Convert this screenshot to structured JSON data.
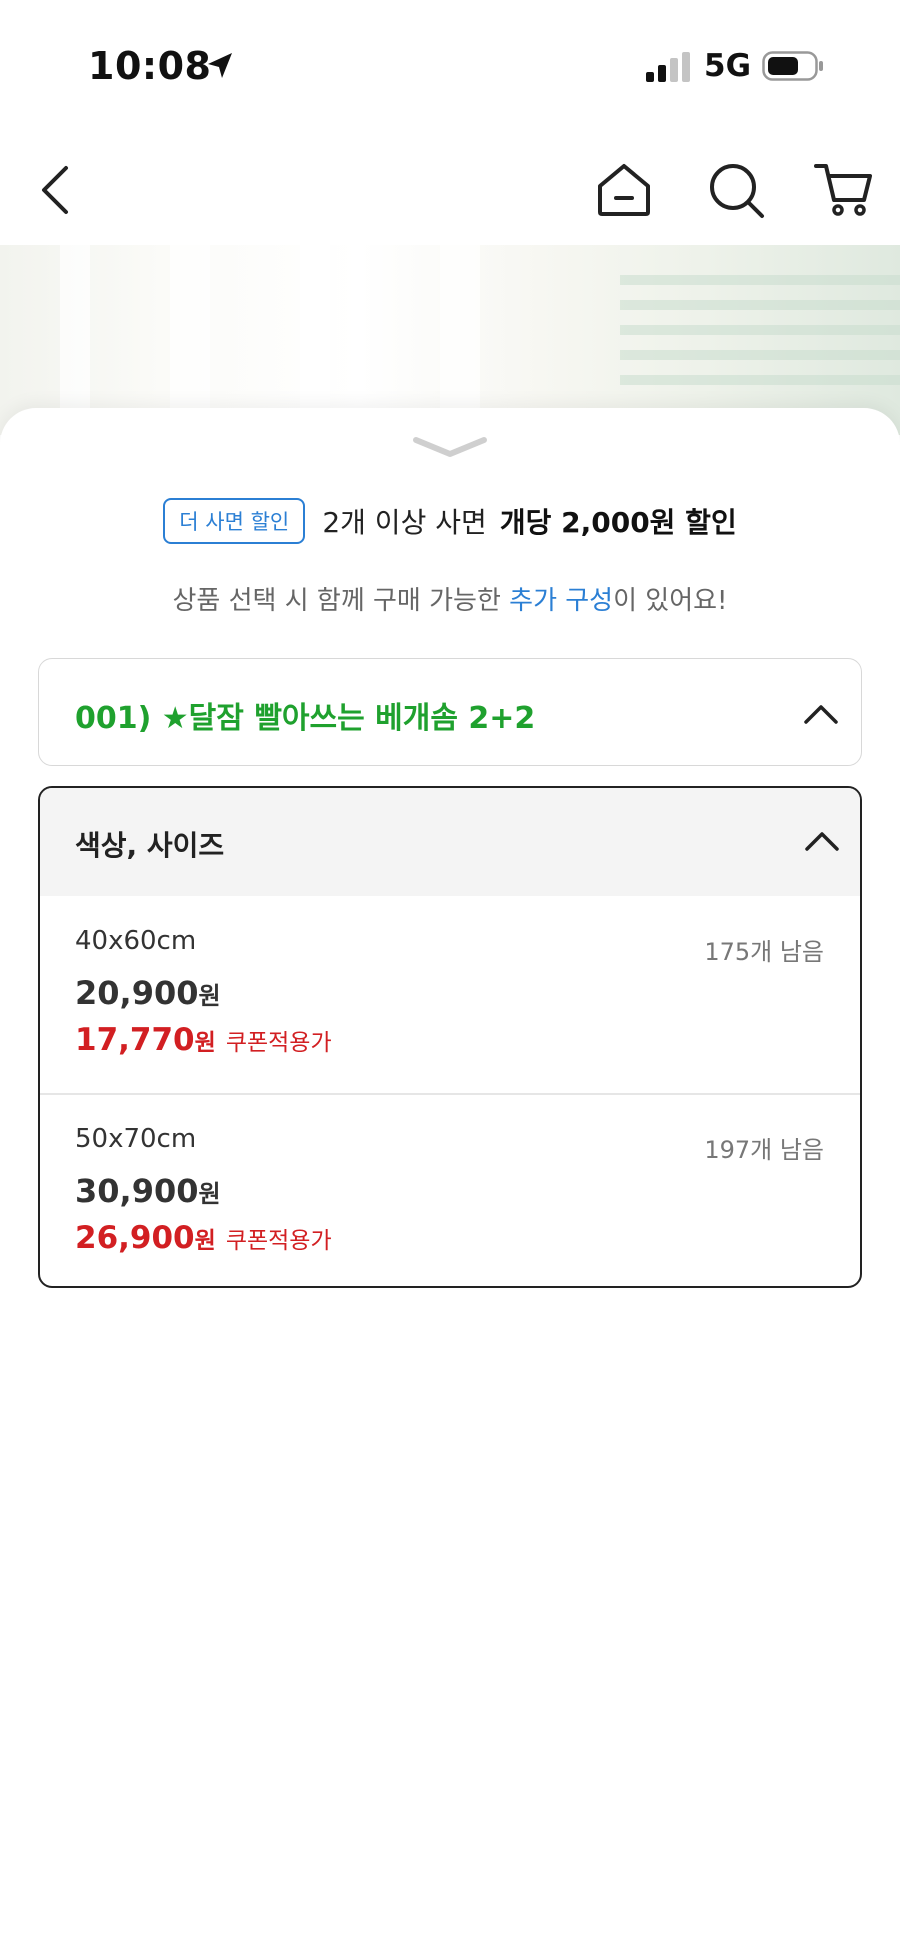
{
  "status_bar": {
    "time": "10:08",
    "network": "5G"
  },
  "nav": {
    "back_icon": "chevron-left-icon",
    "home_icon": "home-icon",
    "search_icon": "search-icon",
    "cart_icon": "cart-icon"
  },
  "sheet": {
    "promo": {
      "badge": "더 사면 할인",
      "text": "2개 이상 사면",
      "strong": "개당 2,000원 할인"
    },
    "addon": {
      "prefix": "상품 선택 시 함께 구매 가능한",
      "highlight": "추가 구성",
      "suffix": "이 있어요!"
    },
    "group": {
      "title": "001) ★달잠 빨아쓰는 베개솜 2+2"
    },
    "options": {
      "header": "색상, 사이즈",
      "items": [
        {
          "size": "40x60cm",
          "stock": "175개 남음",
          "price": "20,900",
          "price_unit": "원",
          "coupon_price": "17,770",
          "coupon_unit": "원",
          "coupon_label": "쿠폰적용가"
        },
        {
          "size": "50x70cm",
          "stock": "197개 남음",
          "price": "30,900",
          "price_unit": "원",
          "coupon_price": "26,900",
          "coupon_unit": "원",
          "coupon_label": "쿠폰적용가"
        }
      ]
    }
  },
  "colors": {
    "accent_blue": "#2b7fd4",
    "group_green": "#1fa12e",
    "coupon_red": "#d21f22"
  }
}
